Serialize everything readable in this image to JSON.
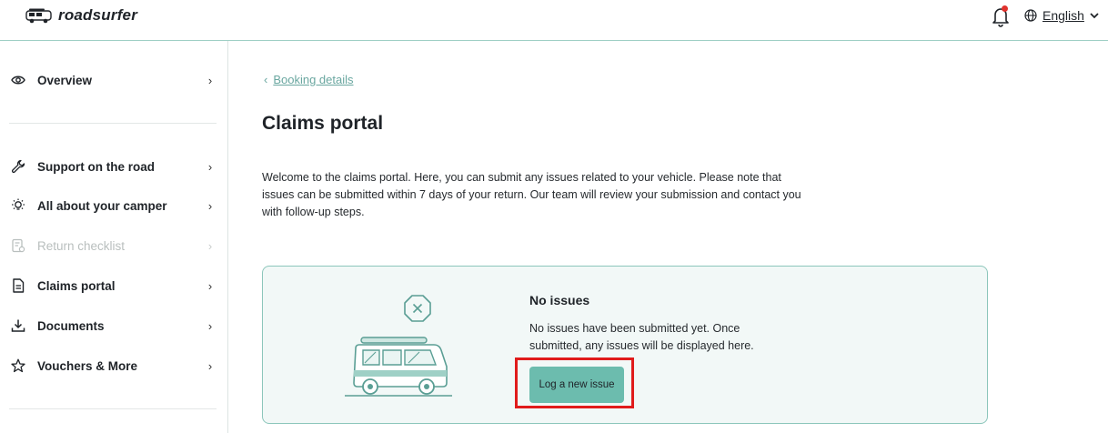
{
  "header": {
    "logo_text": "roadsurfer",
    "logo_icon": "campervan-icon",
    "bell_icon": "bell-icon",
    "language_icon": "globe-icon",
    "language": "English"
  },
  "sidebar": {
    "items": [
      {
        "label": "Overview",
        "icon": "eye-icon",
        "enabled": true
      },
      {
        "label": "Support on the road",
        "icon": "wrench-icon",
        "enabled": true
      },
      {
        "label": "All about your camper",
        "icon": "lightbulb-icon",
        "enabled": true
      },
      {
        "label": "Return checklist",
        "icon": "checklist-icon",
        "enabled": false
      },
      {
        "label": "Claims portal",
        "icon": "document-icon",
        "enabled": true
      },
      {
        "label": "Documents",
        "icon": "download-icon",
        "enabled": true
      },
      {
        "label": "Vouchers & More",
        "icon": "star-icon",
        "enabled": true
      }
    ],
    "chevron": "›"
  },
  "main": {
    "back_link": "Booking details",
    "back_chevron": "‹",
    "title": "Claims portal",
    "intro": "Welcome to the claims portal. Here, you can submit any issues related to your vehicle. Please note that issues can be submitted within 7 days of your return. Our team will review your submission and contact you with follow-up steps.",
    "card": {
      "title": "No issues",
      "message": "No issues have been submitted yet. Once submitted, any issues will be displayed here.",
      "button": "Log a new issue"
    }
  },
  "colors": {
    "accent": "#6cbcae",
    "card_border": "#8cc6bb",
    "card_bg": "#f2f8f7",
    "link": "#6aa7a0",
    "highlight": "#e01b1b",
    "notification_dot": "#e0322d"
  }
}
